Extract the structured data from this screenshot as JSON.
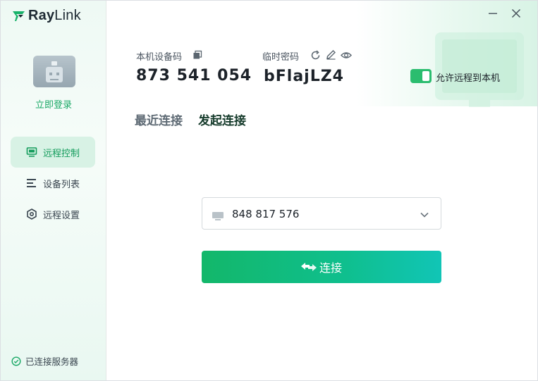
{
  "app": {
    "logo_text_bold": "Ray",
    "logo_text_light": "Link"
  },
  "sidebar": {
    "login_label": "立即登录",
    "items": [
      {
        "label": "远程控制",
        "icon": "monitor-icon",
        "active": true
      },
      {
        "label": "设备列表",
        "icon": "list-icon",
        "active": false
      },
      {
        "label": "远程设置",
        "icon": "settings-hex-icon",
        "active": false
      }
    ],
    "server_status": "已连接服务器"
  },
  "header": {
    "device_code_label": "本机设备码",
    "device_code": "873 541 054",
    "temp_password_label": "临时密码",
    "temp_password": "bFlajLZ4",
    "allow_remote_label": "允许远程到本机",
    "allow_remote_enabled": true
  },
  "tabs": [
    {
      "label": "最近连接",
      "active": false
    },
    {
      "label": "发起连接",
      "active": true
    }
  ],
  "connect": {
    "device_input_value": "848 817 576",
    "connect_label": "连接"
  },
  "colors": {
    "accent": "#1aa866",
    "toggle_on": "#2bbd6f",
    "button_gradient_start": "#13b76a",
    "button_gradient_end": "#11c5b6"
  }
}
